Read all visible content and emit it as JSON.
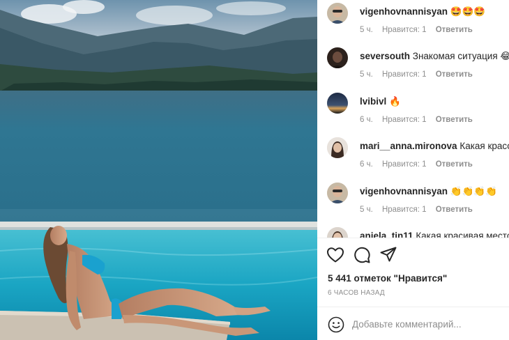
{
  "post_image": {
    "alt": ""
  },
  "comments": [
    {
      "user": "vigenhovnannisyan",
      "text": "🤩🤩🤩",
      "age": "5 ч.",
      "likes": "Нравится: 1",
      "reply": "Ответить",
      "avatar": "avatar-man-sunglasses"
    },
    {
      "user": "seversouth",
      "text": "Знакомая ситуация 😂😂",
      "age": "5 ч.",
      "likes": "Нравится: 1",
      "reply": "Ответить",
      "avatar": "avatar-dark-portrait"
    },
    {
      "user": "lvibivl",
      "text": "🔥",
      "age": "6 ч.",
      "likes": "Нравится: 1",
      "reply": "Ответить",
      "avatar": "avatar-sunset"
    },
    {
      "user": "mari__anna.mironova",
      "text": "Какая красота,",
      "age": "6 ч.",
      "likes": "Нравится: 1",
      "reply": "Ответить",
      "avatar": "avatar-woman"
    },
    {
      "user": "vigenhovnannisyan",
      "text": "👏👏👏👏",
      "age": "5 ч.",
      "likes": "Нравится: 1",
      "reply": "Ответить",
      "avatar": "avatar-man-sunglasses"
    },
    {
      "user": "anjela_tin11",
      "text": "Какая красивая место 🤩",
      "age": "",
      "likes": "",
      "reply": "",
      "avatar": "avatar-woman"
    }
  ],
  "actions": {
    "like_icon": "heart-icon",
    "comment_icon": "comment-bubble-icon",
    "share_icon": "paper-plane-icon"
  },
  "likes_count": "5 441 отметок \"Нравится\"",
  "posted_time": "6 ЧАСОВ НАЗАД",
  "add_comment": {
    "placeholder": "Добавьте комментарий...",
    "emoji_icon": "smiley-icon"
  }
}
